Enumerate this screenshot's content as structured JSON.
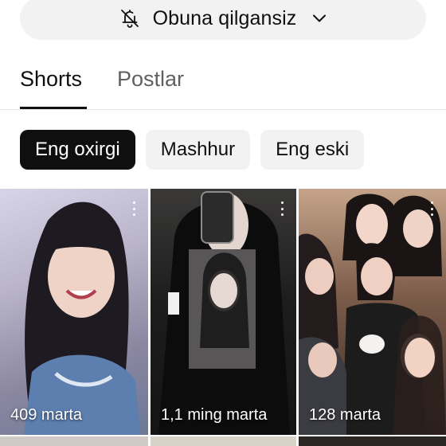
{
  "subscription": {
    "label": "Obuna qilgansiz",
    "icon": "bell-off-icon",
    "dropdown_icon": "chevron-down-icon"
  },
  "tabs": [
    {
      "label": "Shorts",
      "active": true
    },
    {
      "label": "Postlar",
      "active": false
    }
  ],
  "filters": [
    {
      "label": "Eng oxirgi",
      "active": true
    },
    {
      "label": "Mashhur",
      "active": false
    },
    {
      "label": "Eng eski",
      "active": false
    }
  ],
  "shorts": [
    {
      "views": "409 marta"
    },
    {
      "views": "1,1 ming marta"
    },
    {
      "views": "128 marta"
    }
  ],
  "colors": {
    "chip_active_bg": "#0f0f0f",
    "chip_bg": "#f2f2f2",
    "text_primary": "#0f0f0f",
    "text_secondary": "#606060"
  }
}
